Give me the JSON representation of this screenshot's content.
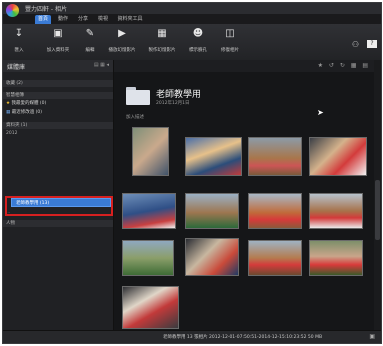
{
  "window": {
    "title": "豐力四軒 - 相片"
  },
  "menu": {
    "tabs": [
      "首頁",
      "動作",
      "分享",
      "檢視",
      "資料夾工具"
    ]
  },
  "toolbar": {
    "buttons": [
      {
        "label": "匯入",
        "icon": "↧"
      },
      {
        "label": "加入資料夾",
        "icon": "▣"
      },
      {
        "label": "編輯",
        "icon": "✎"
      },
      {
        "label": "播放幻燈影片",
        "icon": "▶"
      },
      {
        "label": "製作幻燈影片",
        "icon": "▦"
      },
      {
        "label": "標示臉孔",
        "icon": "☻"
      },
      {
        "label": "修復相片",
        "icon": "◫"
      }
    ]
  },
  "sidebar": {
    "header": "媒體庫",
    "sections": [
      {
        "label": "收藏 (2)"
      },
      {
        "label": "智慧相簿"
      },
      {
        "label": "我最愛的媒體 (0)"
      },
      {
        "label": "最近修改過 (0)"
      },
      {
        "label": "資料夾 (1)"
      },
      {
        "label": "2012"
      },
      {
        "label": "老師教學用 (13)"
      },
      {
        "label": "..."
      },
      {
        "label": "人物"
      }
    ]
  },
  "album": {
    "title": "老師教學用",
    "date": "2012年12月1日",
    "add_label": "加入描述"
  },
  "status": {
    "text": "老師教學用  13 張相片  2012-12-01-07:50:51-2014-12-15:10:23:52 50 MB"
  },
  "colors": {
    "accent": "#3a7bd5",
    "highlight": "#d62020"
  }
}
